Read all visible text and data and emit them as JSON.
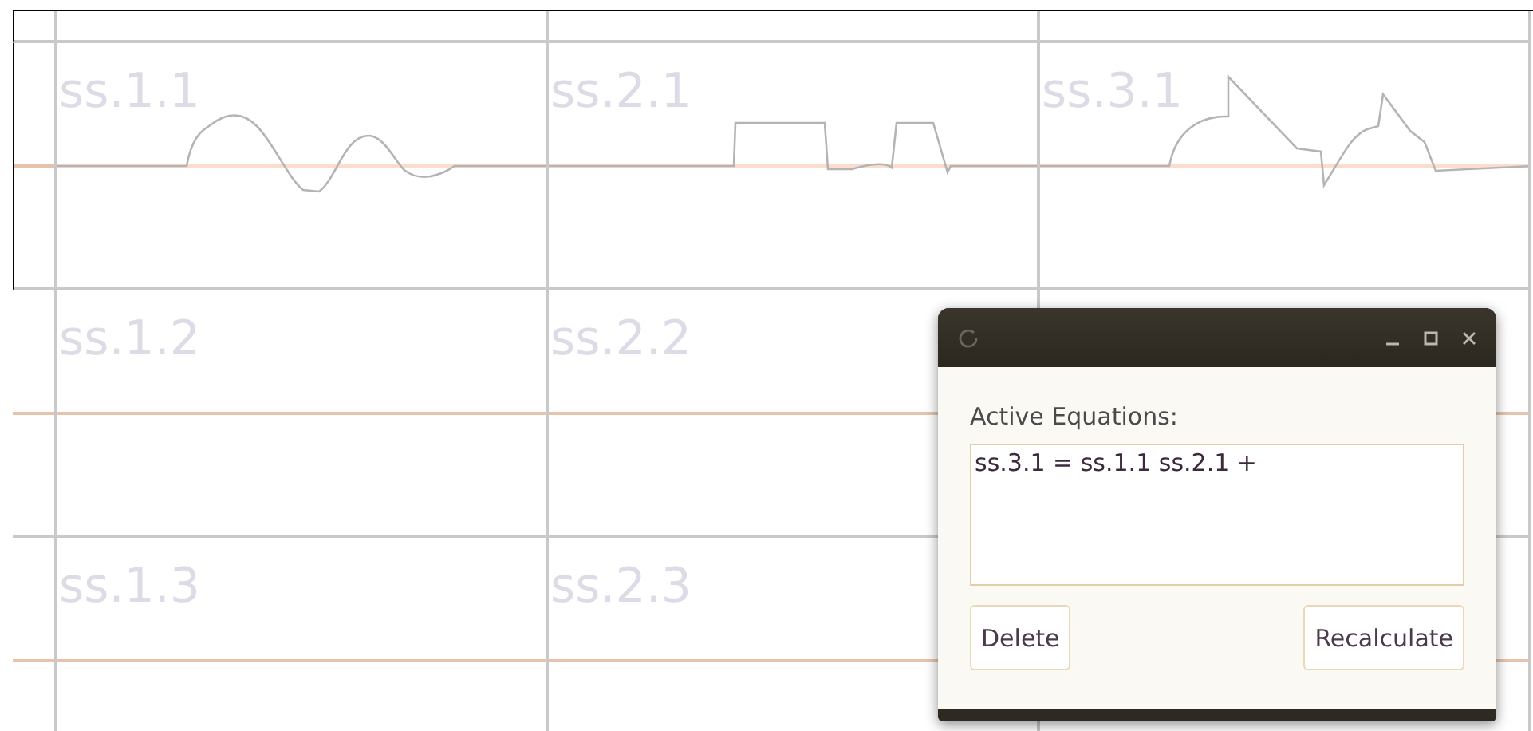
{
  "sheet": {
    "rows": [
      {
        "cells": [
          {
            "label": "ss.1.1",
            "kind": "wave"
          },
          {
            "label": "ss.2.1",
            "kind": "wave"
          },
          {
            "label": "ss.3.1",
            "kind": "wave"
          }
        ]
      },
      {
        "cells": [
          {
            "label": "ss.1.2",
            "kind": "flat"
          },
          {
            "label": "ss.2.2",
            "kind": "flat"
          },
          {
            "kind": "flat"
          }
        ]
      },
      {
        "cells": [
          {
            "label": "ss.1.3",
            "kind": "flat"
          },
          {
            "label": "ss.2.3",
            "kind": "flat"
          },
          {
            "kind": "flat"
          }
        ]
      }
    ]
  },
  "dialog": {
    "label": "Active Equations:",
    "equations": "ss.3.1 = ss.1.1 ss.2.1 +",
    "buttons": [
      {
        "label": "Delete"
      },
      {
        "label": "Recalculate"
      }
    ]
  }
}
